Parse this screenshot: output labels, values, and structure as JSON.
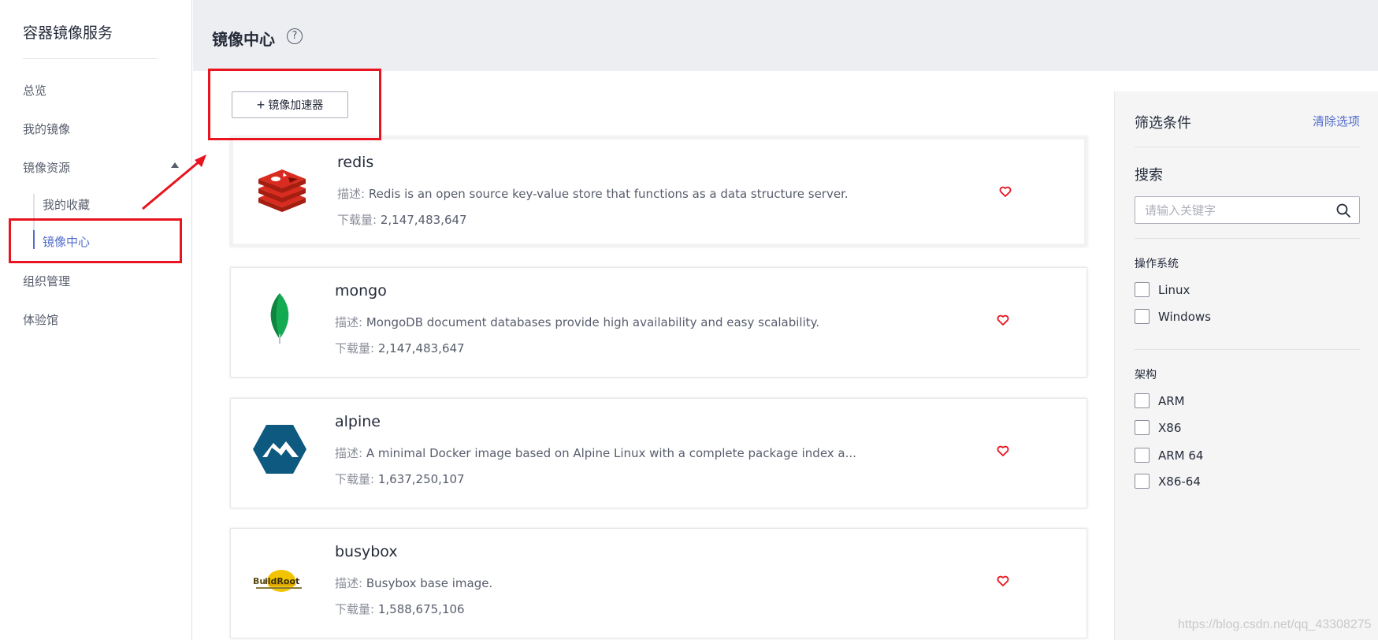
{
  "sidebar": {
    "title": "容器镜像服务",
    "items": {
      "overview": "总览",
      "my_images": "我的镜像",
      "image_resources": "镜像资源",
      "my_favorites": "我的收藏",
      "image_center": "镜像中心",
      "org_management": "组织管理",
      "experience_hall": "体验馆"
    }
  },
  "header": {
    "title": "镜像中心",
    "help_icon": "?"
  },
  "toolbar": {
    "add_accelerator_label": "镜像加速器",
    "plus_icon": "+"
  },
  "images": [
    {
      "name": "redis",
      "desc_label": "描述:",
      "desc": "Redis is an open source key-value store that functions as a data structure server.",
      "downloads_label": "下载量:",
      "downloads": "2,147,483,647",
      "logo": "redis-logo"
    },
    {
      "name": "mongo",
      "desc_label": "描述:",
      "desc": "MongoDB document databases provide high availability and easy scalability.",
      "downloads_label": "下载量:",
      "downloads": "2,147,483,647",
      "logo": "mongo-leaf-logo"
    },
    {
      "name": "alpine",
      "desc_label": "描述:",
      "desc": "A minimal Docker image based on Alpine Linux with a complete package index a...",
      "downloads_label": "下载量:",
      "downloads": "1,637,250,107",
      "logo": "alpine-logo"
    },
    {
      "name": "busybox",
      "desc_label": "描述:",
      "desc": "Busybox base image.",
      "downloads_label": "下载量:",
      "downloads": "1,588,675,106",
      "logo": "buildroot-logo"
    }
  ],
  "filter": {
    "title": "筛选条件",
    "clear": "清除选项",
    "search_title": "搜索",
    "search_placeholder": "请输入关键字",
    "os_title": "操作系统",
    "os_options": [
      "Linux",
      "Windows"
    ],
    "arch_title": "架构",
    "arch_options": [
      "ARM",
      "X86",
      "ARM 64",
      "X86-64"
    ]
  },
  "watermark": "https://blog.csdn.net/qq_43308275",
  "colors": {
    "accent": "#526ecc",
    "annotation_red": "#e8141f",
    "favorite_red": "#e8141f"
  }
}
